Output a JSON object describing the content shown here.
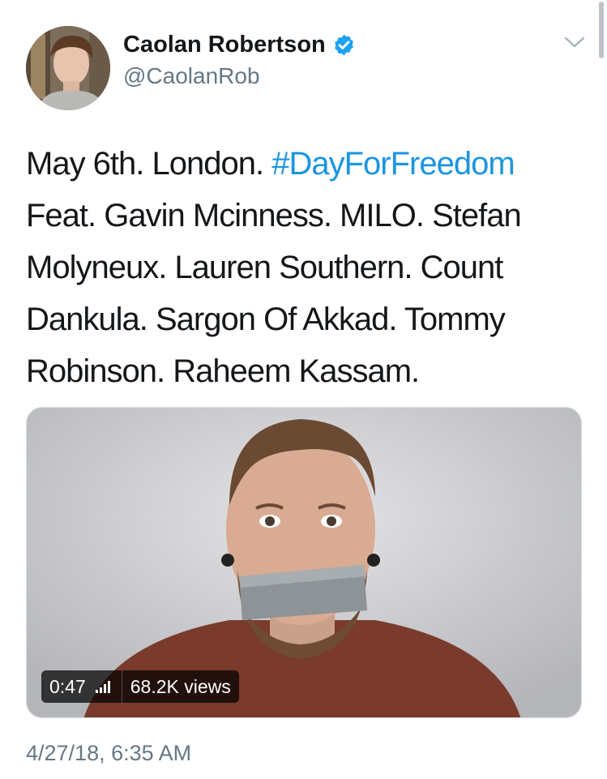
{
  "user": {
    "display_name": "Caolan Robertson",
    "handle": "@CaolanRob",
    "verified": true
  },
  "icons": {
    "verified": "verified-badge-icon",
    "caret": "chevron-down-icon",
    "signal": "signal-bars-icon"
  },
  "tweet": {
    "text_before": "May 6th. London. ",
    "hashtag": "#DayForFreedom",
    "text_after": " Feat. Gavin Mcinness. MILO. Stefan Molyneux. Lauren Southern. Count Dankula. Sargon Of Akkad. Tommy Robinson. Raheem Kassam."
  },
  "video": {
    "duration": "0:47",
    "views": "68.2K views"
  },
  "timestamp": "4/27/18, 6:35 AM",
  "colors": {
    "link": "#1b95e0",
    "verified": "#1da1f2",
    "secondary_text": "#657786"
  }
}
